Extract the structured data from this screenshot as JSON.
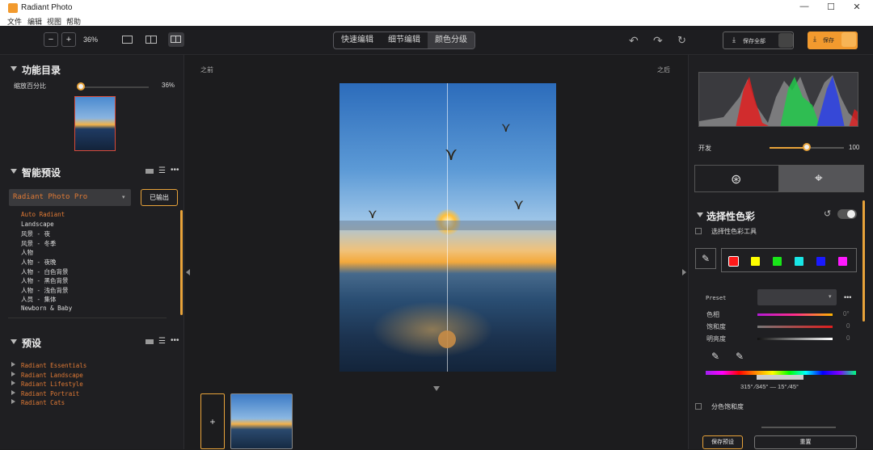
{
  "window": {
    "title": "Radiant Photo",
    "minimize": "—",
    "maximize": "☐",
    "close": "✕"
  },
  "menu": [
    "文件",
    "编辑",
    "视图",
    "帮助"
  ],
  "toolbar": {
    "zoom_minus": "−",
    "zoom_plus": "+",
    "zoom_value": "36%",
    "tabs": [
      {
        "label": "快速编辑",
        "active": false
      },
      {
        "label": "细节编辑",
        "active": false
      },
      {
        "label": "颜色分级",
        "active": true
      }
    ],
    "save_all": "保存全部",
    "save": "保存"
  },
  "left": {
    "func_title": "功能目录",
    "zoom_label": "缩放百分比",
    "zoom_pct": "36%",
    "zoom_level": 0.05,
    "smart_title": "智能预设",
    "product_select": "Radiant Photo   Pro",
    "export_button": "已输出",
    "smart_items": [
      "Auto Radiant",
      "Landscape",
      "风景 - 夜",
      "风景 - 冬季",
      "人物",
      "人物 - 夜晚",
      "人物 - 白色背景",
      "人物 - 黑色背景",
      "人物 - 浅色背景",
      "人员 - 集体",
      "Newborn & Baby"
    ],
    "presets_title": "预设",
    "preset_items": [
      "Radiant Essentials",
      "Radiant Landscape",
      "Radiant Lifestyle",
      "Radiant Portrait",
      "Radiant Cats"
    ]
  },
  "canvas": {
    "before": "之前",
    "after": "之后",
    "add_label": "+"
  },
  "right": {
    "develop_label": "开发",
    "develop_value": "100",
    "develop_level": 1.0,
    "selective_title": "选择性色彩",
    "selective_tool_label": "选择性色彩工具",
    "preset_label": "Preset",
    "more": "•••",
    "hue_label": "色相",
    "hue_value": "0°",
    "sat_label": "饱和度",
    "sat_value": "0",
    "bright_label": "明亮度",
    "bright_value": "0",
    "range_text": "315° ⁄345° — 15° ⁄45°",
    "split_label": "分色饱和度",
    "save_preset": "保存预设",
    "reset": "重置",
    "swatches": [
      "#ff1a1a",
      "#ffff00",
      "#19e619",
      "#19e6e6",
      "#1a1aff",
      "#ff19ff"
    ]
  }
}
